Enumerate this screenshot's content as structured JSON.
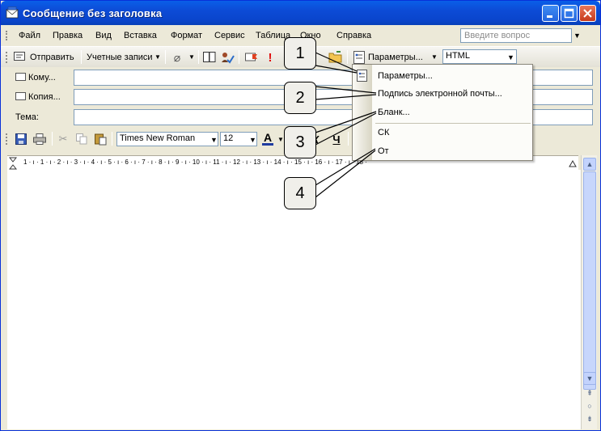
{
  "window": {
    "title": "Сообщение без заголовка"
  },
  "menu": {
    "items": [
      "Файл",
      "Правка",
      "Вид",
      "Вставка",
      "Формат",
      "Сервис",
      "Таблица",
      "Окно",
      "Справка"
    ],
    "ask_placeholder": "Введите вопрос"
  },
  "toolbar1": {
    "send_label": "Отправить",
    "accounts_label": "Учетные записи",
    "params_label": "Параметры...",
    "format_value": "HTML"
  },
  "fields": {
    "to_label": "Кому...",
    "cc_label": "Копия...",
    "subject_label": "Тема:"
  },
  "toolbar2": {
    "font_name": "Times New Roman",
    "font_size": "12",
    "underline_label": "Ч",
    "italic_label": "К"
  },
  "ruler": {
    "marks": "1 · ı · 1 · ı · 2 · ı · 3 · ı · 4 · ı · 5 · ı · 6 · ı · 7 · ı · 8 · ı · 9 · ı · 10 · ı · 11 · ı · 12 · ı · 13 · ı · 14 · ı · 15 · ı · 16 · ı · 17 · ı · 18 ·"
  },
  "dropdown": {
    "items": [
      "Параметры...",
      "Подпись электронной почты...",
      "Бланк...",
      "СК",
      "От"
    ]
  },
  "callouts": [
    "1",
    "2",
    "3",
    "4"
  ]
}
